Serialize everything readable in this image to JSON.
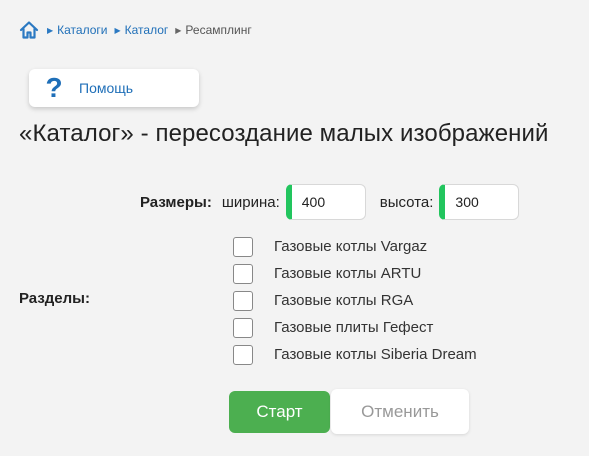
{
  "breadcrumb": {
    "home_icon": "home-icon",
    "items": [
      {
        "label": "Каталоги"
      },
      {
        "label": "Каталог"
      }
    ],
    "current": "Ресамплинг"
  },
  "help": {
    "label": "Помощь",
    "icon": "question-icon"
  },
  "page": {
    "title": "«Каталог» - пересоздание малых изображений"
  },
  "sizes": {
    "label": "Размеры:",
    "width_label": "ширина:",
    "width_value": "400",
    "height_label": "высота:",
    "height_value": "300"
  },
  "sections": {
    "label": "Разделы:",
    "items": [
      {
        "label": "Газовые котлы Vargaz",
        "checked": false
      },
      {
        "label": "Газовые котлы ARTU",
        "checked": false
      },
      {
        "label": "Газовые котлы RGA",
        "checked": false
      },
      {
        "label": "Газовые плиты Гефест",
        "checked": false
      },
      {
        "label": "Газовые котлы Siberia Dream",
        "checked": false
      }
    ]
  },
  "actions": {
    "start_label": "Старт",
    "cancel_label": "Отменить"
  },
  "colors": {
    "accent": "#1f6fb8",
    "success": "#4caf50",
    "input_marker": "#22c55e"
  }
}
